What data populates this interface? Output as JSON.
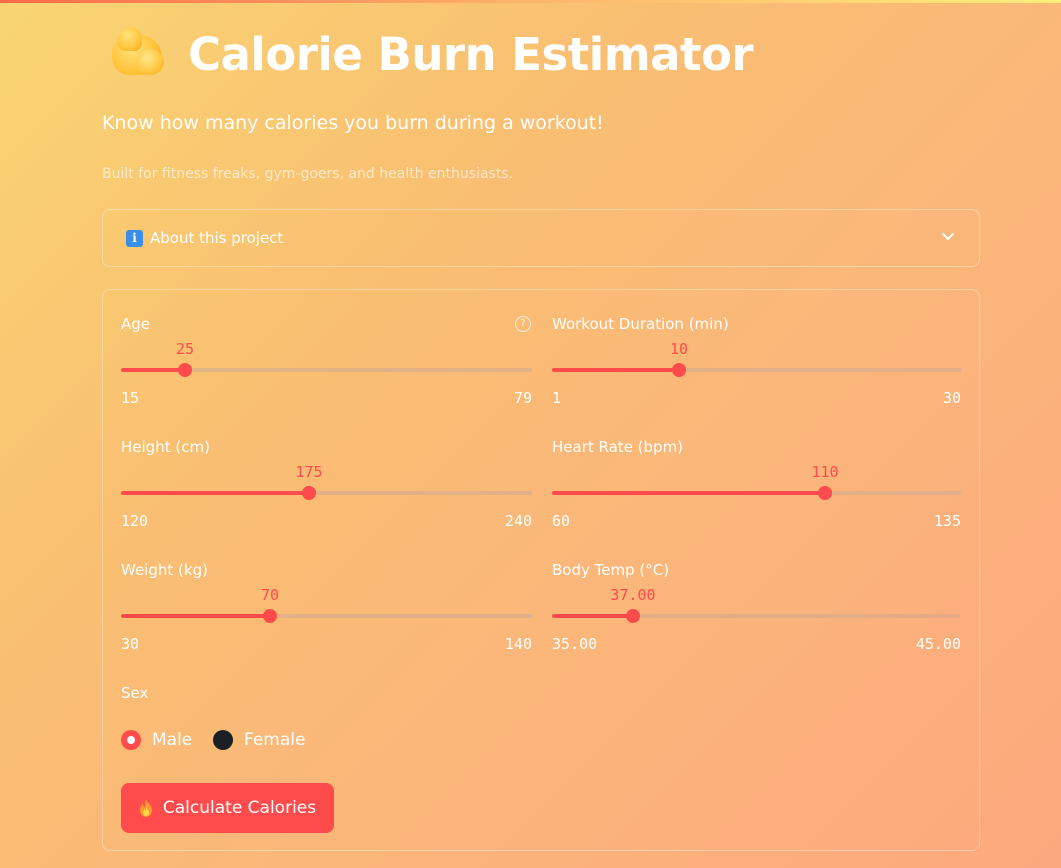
{
  "app": {
    "title": "Calorie Burn Estimator",
    "title_icon": "flexed-biceps-icon",
    "subtitle": "Know how many calories you burn during a workout!",
    "caption": "Built for fitness freaks, gym-goers, and health enthusiasts."
  },
  "expander": {
    "icon": "info-icon",
    "icon_glyph": "i",
    "label": "About this project",
    "expanded": false
  },
  "sliders": {
    "age": {
      "label": "Age",
      "value": "25",
      "min": "15",
      "max": "79",
      "help": "?"
    },
    "duration": {
      "label": "Workout Duration (min)",
      "value": "10",
      "min": "1",
      "max": "30"
    },
    "height": {
      "label": "Height (cm)",
      "value": "175",
      "min": "120",
      "max": "240"
    },
    "heart_rate": {
      "label": "Heart Rate (bpm)",
      "value": "110",
      "min": "60",
      "max": "135"
    },
    "weight": {
      "label": "Weight (kg)",
      "value": "70",
      "min": "30",
      "max": "140"
    },
    "body_temp": {
      "label": "Body Temp (°C)",
      "value": "37.00",
      "min": "35.00",
      "max": "45.00"
    }
  },
  "sex": {
    "label": "Sex",
    "options": [
      "Male",
      "Female"
    ],
    "selected": "Male"
  },
  "submit": {
    "label": "Calculate Calories",
    "icon": "fire-icon"
  },
  "colors": {
    "accent": "#ff4b4b",
    "text": "#ffffff",
    "bg_start": "#f9d572",
    "bg_end": "#fca87e"
  }
}
